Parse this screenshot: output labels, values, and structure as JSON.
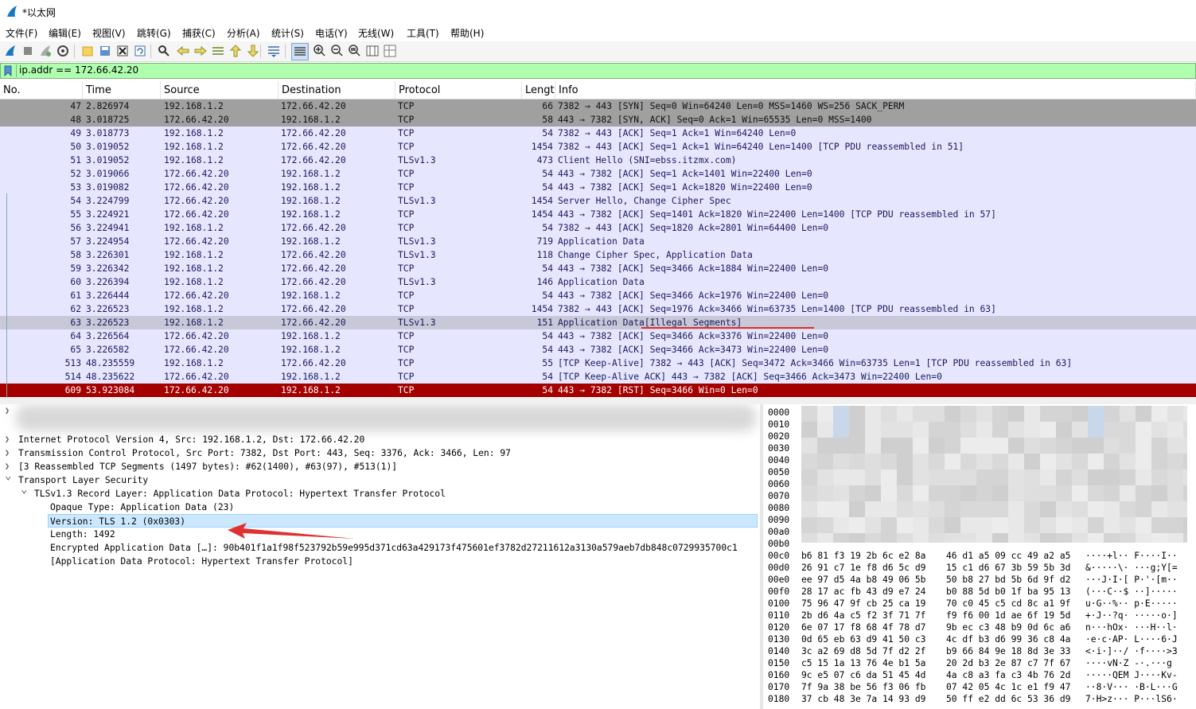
{
  "window": {
    "title": "*以太网"
  },
  "menu": [
    "文件(F)",
    "编辑(E)",
    "视图(V)",
    "跳转(G)",
    "捕获(C)",
    "分析(A)",
    "统计(S)",
    "电话(Y)",
    "无线(W)",
    "工具(T)",
    "帮助(H)"
  ],
  "toolbar": {
    "buttons": [
      {
        "icon": "shark-fin-start-icon"
      },
      {
        "icon": "stop-capture-icon"
      },
      {
        "icon": "restart-capture-icon"
      },
      {
        "icon": "capture-options-icon"
      },
      {
        "icon": "open-file-icon"
      },
      {
        "icon": "save-file-icon"
      },
      {
        "icon": "close-file-icon"
      },
      {
        "icon": "reload-file-icon"
      },
      {
        "icon": "find-packet-icon"
      },
      {
        "icon": "go-back-icon"
      },
      {
        "icon": "go-forward-icon"
      },
      {
        "icon": "go-to-packet-icon"
      },
      {
        "icon": "go-first-icon"
      },
      {
        "icon": "go-last-icon"
      },
      {
        "icon": "auto-scroll-icon"
      },
      {
        "icon": "colorize-icon"
      },
      {
        "icon": "zoom-in-icon"
      },
      {
        "icon": "zoom-out-icon"
      },
      {
        "icon": "zoom-normal-icon"
      },
      {
        "icon": "resize-columns-icon"
      },
      {
        "icon": "layout-icon"
      }
    ]
  },
  "filter": {
    "value": "ip.addr == 172.66.42.20"
  },
  "packet_list": {
    "columns": [
      "No.",
      "Time",
      "Source",
      "Destination",
      "Protocol",
      "Lengt",
      "Info"
    ],
    "rows": [
      {
        "no": "47",
        "time": "2.826974",
        "src": "192.168.1.2",
        "dst": "172.66.42.20",
        "proto": "TCP",
        "len": "66",
        "info": "7382 → 443 [SYN] Seq=0 Win=64240 Len=0 MSS=1460 WS=256 SACK_PERM",
        "style": "syn"
      },
      {
        "no": "48",
        "time": "3.018725",
        "src": "172.66.42.20",
        "dst": "192.168.1.2",
        "proto": "TCP",
        "len": "58",
        "info": "443 → 7382 [SYN, ACK] Seq=0 Ack=1 Win=65535 Len=0 MSS=1400",
        "style": "syn"
      },
      {
        "no": "49",
        "time": "3.018773",
        "src": "192.168.1.2",
        "dst": "172.66.42.20",
        "proto": "TCP",
        "len": "54",
        "info": "7382 → 443 [ACK] Seq=1 Ack=1 Win=64240 Len=0",
        "style": "normal"
      },
      {
        "no": "50",
        "time": "3.019052",
        "src": "192.168.1.2",
        "dst": "172.66.42.20",
        "proto": "TCP",
        "len": "1454",
        "info": "7382 → 443 [ACK] Seq=1 Ack=1 Win=64240 Len=1400 [TCP PDU reassembled in 51]",
        "style": "normal"
      },
      {
        "no": "51",
        "time": "3.019052",
        "src": "192.168.1.2",
        "dst": "172.66.42.20",
        "proto": "TLSv1.3",
        "len": "473",
        "info": "Client Hello (SNI=ebss.itzmx.com)",
        "style": "normal"
      },
      {
        "no": "52",
        "time": "3.019066",
        "src": "172.66.42.20",
        "dst": "192.168.1.2",
        "proto": "TCP",
        "len": "54",
        "info": "443 → 7382 [ACK] Seq=1 Ack=1401 Win=22400 Len=0",
        "style": "normal"
      },
      {
        "no": "53",
        "time": "3.019082",
        "src": "172.66.42.20",
        "dst": "192.168.1.2",
        "proto": "TCP",
        "len": "54",
        "info": "443 → 7382 [ACK] Seq=1 Ack=1820 Win=22400 Len=0",
        "style": "normal"
      },
      {
        "no": "54",
        "time": "3.224799",
        "src": "172.66.42.20",
        "dst": "192.168.1.2",
        "proto": "TLSv1.3",
        "len": "1454",
        "info": "Server Hello, Change Cipher Spec",
        "style": "normal"
      },
      {
        "no": "55",
        "time": "3.224921",
        "src": "172.66.42.20",
        "dst": "192.168.1.2",
        "proto": "TCP",
        "len": "1454",
        "info": "443 → 7382 [ACK] Seq=1401 Ack=1820 Win=22400 Len=1400 [TCP PDU reassembled in 57]",
        "style": "normal"
      },
      {
        "no": "56",
        "time": "3.224941",
        "src": "192.168.1.2",
        "dst": "172.66.42.20",
        "proto": "TCP",
        "len": "54",
        "info": "7382 → 443 [ACK] Seq=1820 Ack=2801 Win=64400 Len=0",
        "style": "normal"
      },
      {
        "no": "57",
        "time": "3.224954",
        "src": "172.66.42.20",
        "dst": "192.168.1.2",
        "proto": "TLSv1.3",
        "len": "719",
        "info": "Application Data",
        "style": "normal"
      },
      {
        "no": "58",
        "time": "3.226301",
        "src": "192.168.1.2",
        "dst": "172.66.42.20",
        "proto": "TLSv1.3",
        "len": "118",
        "info": "Change Cipher Spec, Application Data",
        "style": "normal"
      },
      {
        "no": "59",
        "time": "3.226342",
        "src": "192.168.1.2",
        "dst": "172.66.42.20",
        "proto": "TCP",
        "len": "54",
        "info": "443 → 7382 [ACK] Seq=3466 Ack=1884 Win=22400 Len=0",
        "style": "normal"
      },
      {
        "no": "60",
        "time": "3.226394",
        "src": "192.168.1.2",
        "dst": "172.66.42.20",
        "proto": "TLSv1.3",
        "len": "146",
        "info": "Application Data",
        "style": "normal"
      },
      {
        "no": "61",
        "time": "3.226444",
        "src": "172.66.42.20",
        "dst": "192.168.1.2",
        "proto": "TCP",
        "len": "54",
        "info": "443 → 7382 [ACK] Seq=3466 Ack=1976 Win=22400 Len=0",
        "style": "normal"
      },
      {
        "no": "62",
        "time": "3.226523",
        "src": "192.168.1.2",
        "dst": "172.66.42.20",
        "proto": "TCP",
        "len": "1454",
        "info": "7382 → 443 [ACK] Seq=1976 Ack=3466 Win=63735 Len=1400 [TCP PDU reassembled in 63]",
        "style": "normal"
      },
      {
        "no": "63",
        "time": "3.226523",
        "src": "192.168.1.2",
        "dst": "172.66.42.20",
        "proto": "TLSv1.3",
        "len": "151",
        "info": "Application Data[Illegal Segments]",
        "style": "selected"
      },
      {
        "no": "64",
        "time": "3.226564",
        "src": "172.66.42.20",
        "dst": "192.168.1.2",
        "proto": "TCP",
        "len": "54",
        "info": "443 → 7382 [ACK] Seq=3466 Ack=3376 Win=22400 Len=0",
        "style": "normal"
      },
      {
        "no": "65",
        "time": "3.226582",
        "src": "172.66.42.20",
        "dst": "192.168.1.2",
        "proto": "TCP",
        "len": "54",
        "info": "443 → 7382 [ACK] Seq=3466 Ack=3473 Win=22400 Len=0",
        "style": "normal"
      },
      {
        "no": "513",
        "time": "48.235559",
        "src": "192.168.1.2",
        "dst": "172.66.42.20",
        "proto": "TCP",
        "len": "55",
        "info": "[TCP Keep-Alive] 7382 → 443 [ACK] Seq=3472 Ack=3466 Win=63735 Len=1 [TCP PDU reassembled in 63]",
        "style": "normal"
      },
      {
        "no": "514",
        "time": "48.235622",
        "src": "172.66.42.20",
        "dst": "192.168.1.2",
        "proto": "TCP",
        "len": "54",
        "info": "[TCP Keep-Alive ACK] 443 → 7382 [ACK] Seq=3466 Ack=3473 Win=22400 Len=0",
        "style": "normal"
      },
      {
        "no": "609",
        "time": "53.923084",
        "src": "172.66.42.20",
        "dst": "192.168.1.2",
        "proto": "TCP",
        "len": "54",
        "info": "443 → 7382 [RST] Seq=3466 Win=0 Len=0",
        "style": "rst"
      }
    ]
  },
  "details": {
    "rows": [
      {
        "arrow": "collapsed",
        "indent": 0,
        "text": "Internet Protocol Version 4, Src: 192.168.1.2, Dst: 172.66.42.20",
        "selected": false
      },
      {
        "arrow": "collapsed",
        "indent": 0,
        "text": "Transmission Control Protocol, Src Port: 7382, Dst Port: 443, Seq: 3376, Ack: 3466, Len: 97",
        "selected": false
      },
      {
        "arrow": "collapsed",
        "indent": 0,
        "text": "[3 Reassembled TCP Segments (1497 bytes): #62(1400), #63(97), #513(1)]",
        "selected": false
      },
      {
        "arrow": "expanded",
        "indent": 0,
        "text": "Transport Layer Security",
        "selected": false
      },
      {
        "arrow": "expanded",
        "indent": 1,
        "text": "TLSv1.3 Record Layer: Application Data Protocol: Hypertext Transfer Protocol",
        "selected": false
      },
      {
        "arrow": "none",
        "indent": 2,
        "text": "Opaque Type: Application Data (23)",
        "selected": false
      },
      {
        "arrow": "none",
        "indent": 2,
        "text": "Version: TLS 1.2 (0x0303)",
        "selected": true
      },
      {
        "arrow": "none",
        "indent": 2,
        "text": "Length: 1492",
        "selected": false
      },
      {
        "arrow": "none",
        "indent": 2,
        "text": "Encrypted Application Data […]: 90b401f1a1f98f523792b59e995d371cd63a429173f475601ef3782d27211612a3130a579aeb7db848c0729935700c1",
        "selected": false
      },
      {
        "arrow": "none",
        "indent": 2,
        "text": "[Application Data Protocol: Hypertext Transfer Protocol]",
        "selected": false
      }
    ]
  },
  "hex": {
    "blurred_offsets": [
      "0000",
      "0010",
      "0020",
      "0030",
      "0040",
      "0050",
      "0060",
      "0070",
      "0080",
      "0090",
      "00a0",
      "00b0"
    ],
    "rows": [
      {
        "off": "00c0",
        "b1": "b6 81 f3 19 2b 6c e2 8a",
        "b2": "46 d1 a5 09 cc 49 a2 a5",
        "a": "····+l·· F····I··"
      },
      {
        "off": "00d0",
        "b1": "26 91 c7 1e f8 d6 5c d9",
        "b2": "15 c1 d6 67 3b 59 5b 3d",
        "a": "&·····\\· ···g;Y[="
      },
      {
        "off": "00e0",
        "b1": "ee 97 d5 4a b8 49 06 5b",
        "b2": "50 b8 27 bd 5b 6d 9f d2",
        "a": "···J·I·[ P·'·[m··"
      },
      {
        "off": "00f0",
        "b1": "28 17 ac fb 43 d9 e7 24",
        "b2": "b0 88 5d b0 1f ba 95 13",
        "a": "(···C··$ ··]·····"
      },
      {
        "off": "0100",
        "b1": "75 96 47 9f cb 25 ca 19",
        "b2": "70 c0 45 c5 cd 8c a1 9f",
        "a": "u·G··%·· p·E·····"
      },
      {
        "off": "0110",
        "b1": "2b d6 4a c5 f2 3f 71 7f",
        "b2": "f9 f6 00 1d ae 6f 19 5d",
        "a": "+·J··?q· ·····o·]"
      },
      {
        "off": "0120",
        "b1": "6e 07 17 f8 68 4f 78 d7",
        "b2": "9b ec c3 48 b9 0d 6c a6",
        "a": "n···hOx· ···H··l·"
      },
      {
        "off": "0130",
        "b1": "0d 65 eb 63 d9 41 50 c3",
        "b2": "4c df b3 d6 99 36 c8 4a",
        "a": "·e·c·AP· L····6·J"
      },
      {
        "off": "0140",
        "b1": "3c a2 69 d8 5d 7f d2 2f",
        "b2": "b9 66 84 9e 18 8d 3e 33",
        "a": "<·i·]··/ ·f····>3"
      },
      {
        "off": "0150",
        "b1": "c5 15 1a 13 76 4e b1 5a",
        "b2": "20 2d b3 2e 87 c7 7f 67",
        "a": "····vN·Z  -·.···g"
      },
      {
        "off": "0160",
        "b1": "9c e5 07 c6 da 51 45 4d",
        "b2": "4a c8 a3 fa c3 4b 76 2d",
        "a": "·····QEM J····Kv-"
      },
      {
        "off": "0170",
        "b1": "7f 9a 38 be 56 f3 06 fb",
        "b2": "07 42 05 4c 1c e1 f9 47",
        "a": "··8·V··· ·B·L···G"
      },
      {
        "off": "0180",
        "b1": "37 cb 48 3e 7a 14 93 d9",
        "b2": "50 ff e2 dd 6c 53 36 d9",
        "a": "7·H>z··· P···lS6·"
      }
    ]
  },
  "colors": {
    "normal_row": "#e7e6ff",
    "syn_row": "#a0a0a0",
    "selected_row": "#c8c8d8",
    "rst_row": "#a40000",
    "filter_bg": "#afffaf",
    "annotation": "#e03030"
  }
}
